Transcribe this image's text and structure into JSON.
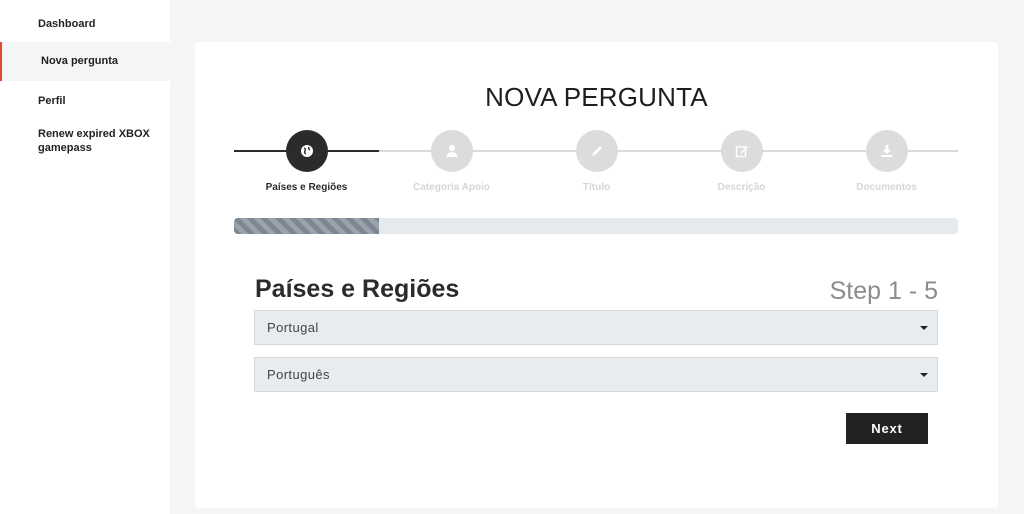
{
  "sidebar": {
    "items": [
      {
        "label": "Dashboard"
      },
      {
        "label": "Nova pergunta",
        "active": true
      },
      {
        "label": "Perfil"
      },
      {
        "label": "Renew expired XBOX gamepass"
      }
    ]
  },
  "page": {
    "title": "NOVA PERGUNTA"
  },
  "stepper": {
    "steps": [
      {
        "label": "Países e Regiões",
        "icon": "globe-icon",
        "active": true
      },
      {
        "label": "Categoria Apoio",
        "icon": "user-support-icon",
        "active": false
      },
      {
        "label": "Título",
        "icon": "pencil-icon",
        "active": false
      },
      {
        "label": "Descrição",
        "icon": "edit-icon",
        "active": false
      },
      {
        "label": "Documentos",
        "icon": "download-icon",
        "active": false
      }
    ],
    "progress": 0.2
  },
  "form": {
    "title": "Países e Regiões",
    "step_count": "Step 1 - 5",
    "country_select": "Portugal",
    "language_select": "Português",
    "next_label": "Next"
  },
  "colors": {
    "accent": "#e04a2f",
    "active_step": "#2b2b2b",
    "inactive_step": "#dadcde",
    "background": "#f3f5f7"
  }
}
